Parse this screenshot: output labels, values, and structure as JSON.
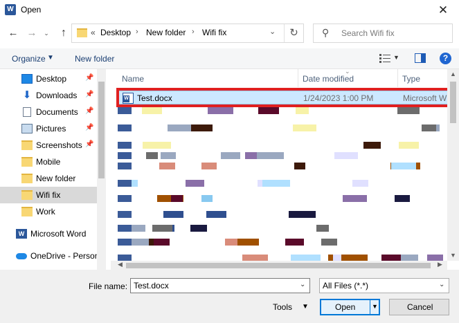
{
  "window": {
    "title": "Open",
    "app_icon_letter": "W"
  },
  "nav": {
    "overflow": "«",
    "breadcrumb": [
      "Desktop",
      "New folder",
      "Wifi fix"
    ],
    "search_placeholder": "Search Wifi fix"
  },
  "commands": {
    "organize": "Organize",
    "new_folder": "New folder",
    "help": "?"
  },
  "sidebar": {
    "items": [
      {
        "label": "Desktop",
        "icon": "desktop-icon"
      },
      {
        "label": "Downloads",
        "icon": "download-icon"
      },
      {
        "label": "Documents",
        "icon": "documents-icon"
      },
      {
        "label": "Pictures",
        "icon": "pictures-icon"
      },
      {
        "label": "Screenshots",
        "icon": "folder-icon"
      },
      {
        "label": "Mobile",
        "icon": "folder-icon"
      },
      {
        "label": "New folder",
        "icon": "folder-icon"
      },
      {
        "label": "Wifi fix",
        "icon": "folder-icon"
      },
      {
        "label": "Work",
        "icon": "folder-icon"
      },
      {
        "label": "Microsoft Word",
        "icon": "word-icon"
      },
      {
        "label": "OneDrive - Person",
        "icon": "onedrive-icon"
      }
    ]
  },
  "columns": {
    "name": "Name",
    "date": "Date modified",
    "type": "Type"
  },
  "files": [
    {
      "name": "Test.docx",
      "date": "1/24/2023 1:00 PM",
      "type": "Microsoft W"
    }
  ],
  "footer": {
    "file_name_label": "File name:",
    "file_name_value": "Test.docx",
    "file_type": "All Files (*.*)",
    "tools": "Tools",
    "open": "Open",
    "cancel": "Cancel"
  },
  "colors": {
    "selection": "#cce8ff",
    "highlight": "#e02020",
    "accent": "#0078d7"
  }
}
